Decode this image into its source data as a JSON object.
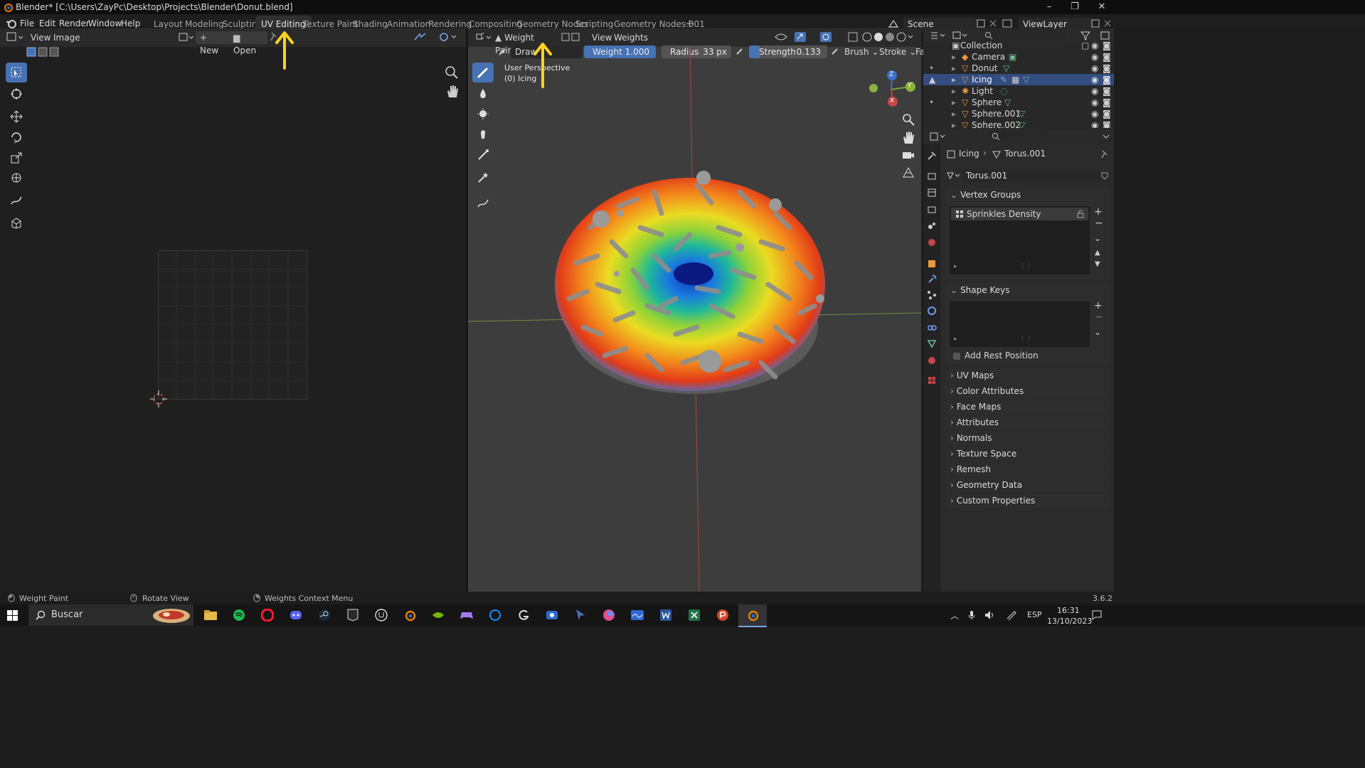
{
  "window": {
    "title": "Blender* [C:\\Users\\ZayPc\\Desktop\\Projects\\Blender\\Donut.blend]",
    "minimize": "–",
    "restore": "❐",
    "close": "✕"
  },
  "menus": [
    "File",
    "Edit",
    "Render",
    "Window",
    "Help"
  ],
  "workspace_tabs": [
    "Layout",
    "Modeling",
    "Sculpting",
    "UV Editing",
    "Texture Paint",
    "Shading",
    "Animation",
    "Rendering",
    "Compositing",
    "Geometry Nodes",
    "Scripting",
    "Geometry Nodes.001"
  ],
  "active_workspace": "UV Editing",
  "add_workspace": "+",
  "scene": "Scene",
  "view_layer": "ViewLayer",
  "uv_editor": {
    "menus": [
      "View",
      "Image"
    ],
    "new_label": "New",
    "open_label": "Open"
  },
  "viewport": {
    "mode": "Weight Paint",
    "menus": [
      "View",
      "Weights"
    ],
    "brush_name": "Draw",
    "weight_label": "Weight",
    "weight_value": "1.000",
    "radius_label": "Radius",
    "radius_value": "33 px",
    "strength_label": "Strength",
    "strength_value": "0.133",
    "brush_menu": "Brush",
    "stroke_menu": "Stroke",
    "falloff_menu": "Fa",
    "overlay_line1": "User Perspective",
    "overlay_line2": "(0) Icing",
    "gizmo_axes": [
      "Z",
      "Y",
      "X"
    ]
  },
  "outliner": {
    "rows": [
      {
        "label": "Collection",
        "icon": "collection-icon"
      },
      {
        "label": "Camera",
        "icon": "camera-icon"
      },
      {
        "label": "Donut",
        "icon": "mesh-icon"
      },
      {
        "label": "Icing",
        "icon": "mesh-icon",
        "selected": true
      },
      {
        "label": "Light",
        "icon": "light-icon"
      },
      {
        "label": "Sphere",
        "icon": "mesh-icon"
      },
      {
        "label": "Sphere.001",
        "icon": "mesh-icon"
      },
      {
        "label": "Sphere.002",
        "icon": "mesh-icon"
      }
    ]
  },
  "properties": {
    "breadcrumb_object": "Icing",
    "breadcrumb_mesh": "Torus.001",
    "mesh_name": "Torus.001",
    "vertex_groups_title": "Vertex Groups",
    "vertex_group_item": "Sprinkles Density",
    "shape_keys_title": "Shape Keys",
    "add_rest_position": "Add Rest Position",
    "collapsed_panels": [
      "UV Maps",
      "Color Attributes",
      "Face Maps",
      "Attributes",
      "Normals",
      "Texture Space",
      "Remesh",
      "Geometry Data",
      "Custom Properties"
    ]
  },
  "statusbar": {
    "left_action": "Weight Paint",
    "middle_action": "Rotate View",
    "right_action": "Weights Context Menu",
    "version": "3.6.2"
  },
  "taskbar": {
    "search_placeholder": "Buscar",
    "language": "ESP",
    "time": "16:31",
    "date": "13/10/2023"
  },
  "colors": {
    "accent_blue": "#4772b3",
    "annotation_arrow": "#ffd21f",
    "selection_row": "#334d80"
  }
}
